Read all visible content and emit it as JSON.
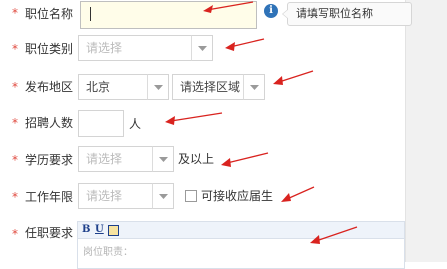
{
  "colors": {
    "required_mark": "#e04a3f",
    "annotation_arrow": "#d9231f",
    "info_icon": "#2f73b8",
    "focus_field_bg": "#fffde9"
  },
  "required_mark": "*",
  "form": {
    "job_name": {
      "label": "职位名称",
      "value": "",
      "tooltip_icon": "info-icon",
      "tooltip": "请填写职位名称"
    },
    "job_category": {
      "label": "职位类别",
      "placeholder": "请选择"
    },
    "location": {
      "label": "发布地区",
      "city": "北京",
      "district": "请选择区域"
    },
    "headcount": {
      "label": "招聘人数",
      "value": "",
      "unit": "人"
    },
    "education": {
      "label": "学历要求",
      "placeholder": "请选择",
      "suffix": "及以上"
    },
    "experience": {
      "label": "工作年限",
      "placeholder": "请选择",
      "checkbox_label": "可接收应届生",
      "checkbox_checked": false
    },
    "requirements": {
      "label": "任职要求",
      "toolbar": {
        "bold": "B",
        "underline": "U",
        "image_icon": "image-icon"
      },
      "placeholder": "岗位职责："
    }
  }
}
